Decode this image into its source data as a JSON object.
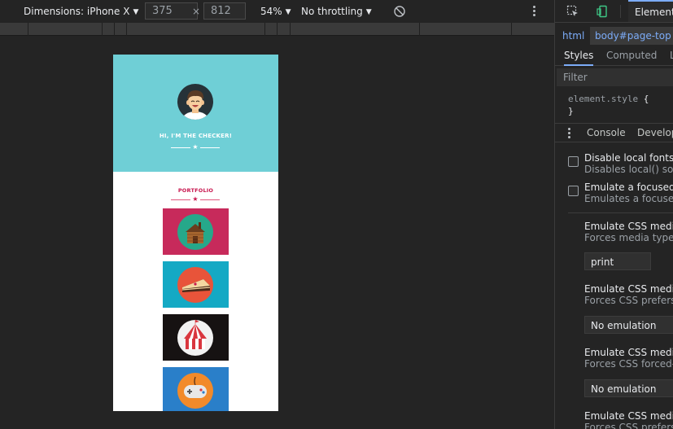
{
  "device_toolbar": {
    "dimensions_label": "Dimensions: iPhone X",
    "width_value": "375",
    "times_symbol": "×",
    "height_value": "812",
    "zoom": "54%",
    "throttling": "No throttling"
  },
  "emulated_page": {
    "hero_title": "HI, I'M THE CHECKER!",
    "portfolio_title": "PORTFOLIO",
    "hero_bg": "#6fcfd6",
    "accent": "#c8174f",
    "portfolio_items": [
      {
        "icon": "cabin-icon",
        "bg": "#c72a5b"
      },
      {
        "icon": "cake-icon",
        "bg": "#14a9c4"
      },
      {
        "icon": "circus-tent-icon",
        "bg": "#161212"
      },
      {
        "icon": "game-controller-icon",
        "bg": "#2a7fc9"
      }
    ]
  },
  "devtools": {
    "elements_tab": "Element",
    "breadcrumb_html": "html",
    "breadcrumb_body": "body#page-top",
    "tabs": {
      "styles": "Styles",
      "computed": "Computed",
      "layout": "L"
    },
    "filter_placeholder": "Filter",
    "element_style": "element.style",
    "brace_open": "{",
    "brace_close": "}",
    "drawer": {
      "console": "Console",
      "developer": "Develop"
    },
    "rendering": {
      "disable_local_fonts_title": "Disable local fonts",
      "disable_local_fonts_desc": "Disables local() sour",
      "focused_page_title": "Emulate a focused p",
      "focused_page_desc": "Emulates a focused p",
      "media_type_title": "Emulate CSS media t",
      "media_type_desc": "Forces media type fo",
      "media_type_value": "print",
      "color_scheme_title": "Emulate CSS media f",
      "color_scheme_desc": "Forces CSS prefers-c",
      "color_scheme_value": "No emulation",
      "forced_colors_title": "Emulate CSS media f",
      "forced_colors_desc": "Forces CSS forced-co",
      "forced_colors_value": "No emulation",
      "reduced_motion_title": "Emulate CSS media f",
      "reduced_motion_desc": "Forces CSS prefers-r"
    }
  }
}
